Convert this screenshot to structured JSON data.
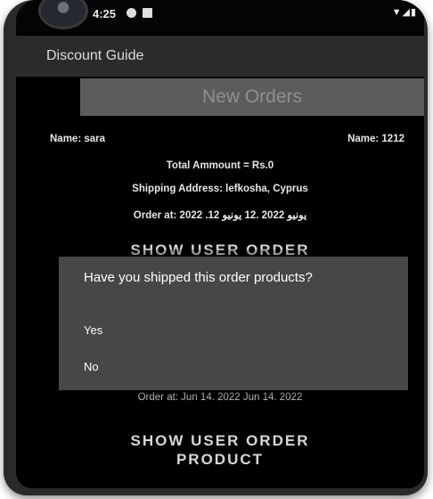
{
  "status_bar": {
    "time": "4:25",
    "left_icons": [
      "circle-status-icon",
      "square-status-icon"
    ],
    "right_icons": [
      "wifi-icon",
      "signal-icon",
      "battery-icon"
    ]
  },
  "app_bar": {
    "title": "Discount Guide"
  },
  "banner": {
    "title": "New Orders"
  },
  "order1": {
    "name_left": "Name: sara",
    "name_right": "Name: 1212",
    "total": "Total Ammount = Rs.0",
    "address": "Shipping Address: lefkosha, Cyprus",
    "order_at": "Order at: 2022 .12 يونيو 2022 .12 يونيو",
    "button": "SHOW USER ORDER"
  },
  "order2": {
    "order_at": "Order at: Jun 14. 2022 Jun 14. 2022",
    "button_line1": "SHOW USER ORDER",
    "button_line2": "PRODUCT"
  },
  "dialog": {
    "title": "Have you shipped this order products?",
    "yes": "Yes",
    "no": "No"
  },
  "colors": {
    "background": "#000000",
    "appbar": "#2b2b2b",
    "banner": "#5c5c5c",
    "dialog": "#474747"
  }
}
